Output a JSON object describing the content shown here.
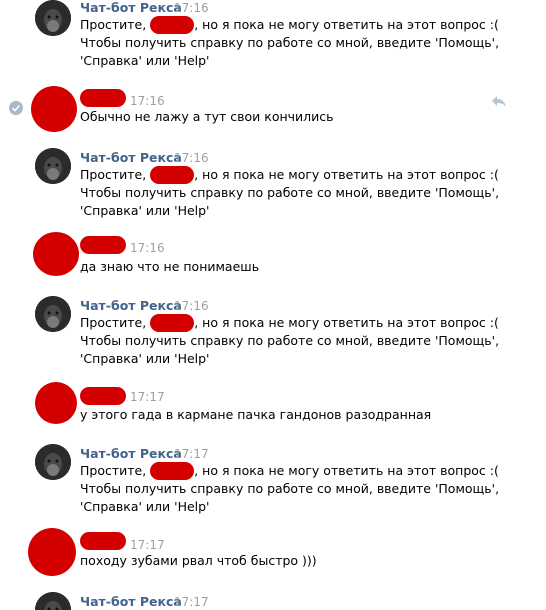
{
  "bot": {
    "name": "Чат-бот Рекса",
    "reply_line1_pre": "Простите,",
    "reply_line1_post": ", но я пока не могу ответить на этот вопрос :(",
    "reply_line2": "Чтобы получить справку по работе со мной, введите 'Помощь',",
    "reply_line3": "'Справка' или 'Help'"
  },
  "messages": [
    {
      "author": "bot",
      "time": "17:16"
    },
    {
      "author": "user",
      "time": "17:16",
      "text": "Обычно не лажу а тут свои кончились"
    },
    {
      "author": "bot",
      "time": "17:16"
    },
    {
      "author": "user",
      "time": "17:16",
      "text": "да знаю что не понимаешь"
    },
    {
      "author": "bot",
      "time": "17:16"
    },
    {
      "author": "user",
      "time": "17:17",
      "text": "у этого гада в кармане пачка гандонов разодранная"
    },
    {
      "author": "bot",
      "time": "17:17"
    },
    {
      "author": "user",
      "time": "17:17",
      "text": "походу зубами рвал чтоб быстро )))"
    },
    {
      "author": "bot",
      "time": "17:17"
    }
  ],
  "icons": {
    "selected": "check-circle-icon",
    "reply": "reply-arrow-icon"
  },
  "colors": {
    "author_link": "#42648b",
    "timestamp": "#a0a0a0",
    "redaction": "#d40000"
  }
}
